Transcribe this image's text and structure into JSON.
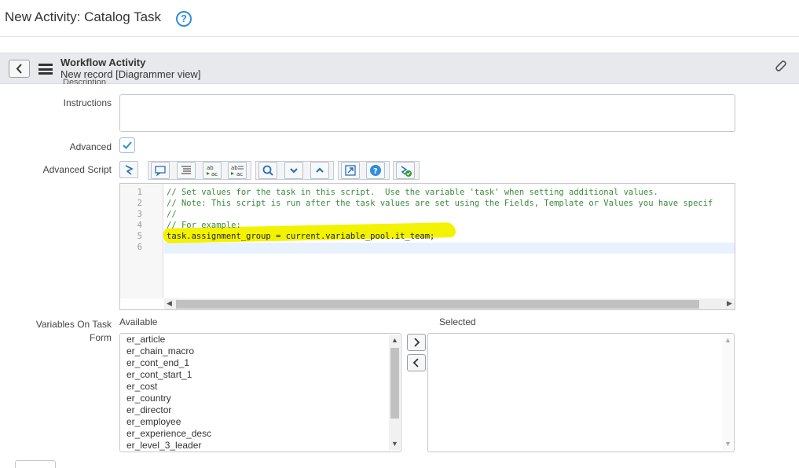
{
  "dialog": {
    "title": "New Activity: Catalog Task",
    "help_glyph": "?"
  },
  "header": {
    "title": "Workflow Activity",
    "subtitle": "New record [Diagrammer view]"
  },
  "fields": {
    "description_label": "Description",
    "instructions_label": "Instructions",
    "instructions_value": "",
    "advanced_label": "Advanced",
    "advanced_checked": true,
    "advanced_script_label": "Advanced Script",
    "variables_label_line1": "Variables On Task",
    "variables_label_line2": "Form"
  },
  "toolbar": {
    "buttons": [
      "toggle-syntax",
      "comment",
      "format-code",
      "replace",
      "replace-all",
      "search",
      "next",
      "previous",
      "fullscreen",
      "help",
      "script-debugger"
    ]
  },
  "script": {
    "line_numbers": [
      "1",
      "2",
      "3",
      "4",
      "5",
      "6"
    ],
    "lines": [
      "// Set values for the task in this script.  Use the variable 'task' when setting additional values.",
      "// Note: This script is run after the task values are set using the Fields, Template or Values you have specif",
      "//",
      "// For example:",
      "task.assignment_group = current.variable_pool.it_team;",
      ""
    ],
    "highlight_color": "#f3f200"
  },
  "slushbucket": {
    "available_label": "Available",
    "selected_label": "Selected",
    "available": [
      "er_article",
      "er_chain_macro",
      "er_cont_end_1",
      "er_cont_start_1",
      "er_cost",
      "er_country",
      "er_director",
      "er_employee",
      "er_experience_desc",
      "er_level_3_leader"
    ],
    "selected": []
  },
  "colors": {
    "accent": "#2e8ed8",
    "header_bg": "#e7e9ec",
    "comment": "#3b8a3b"
  }
}
